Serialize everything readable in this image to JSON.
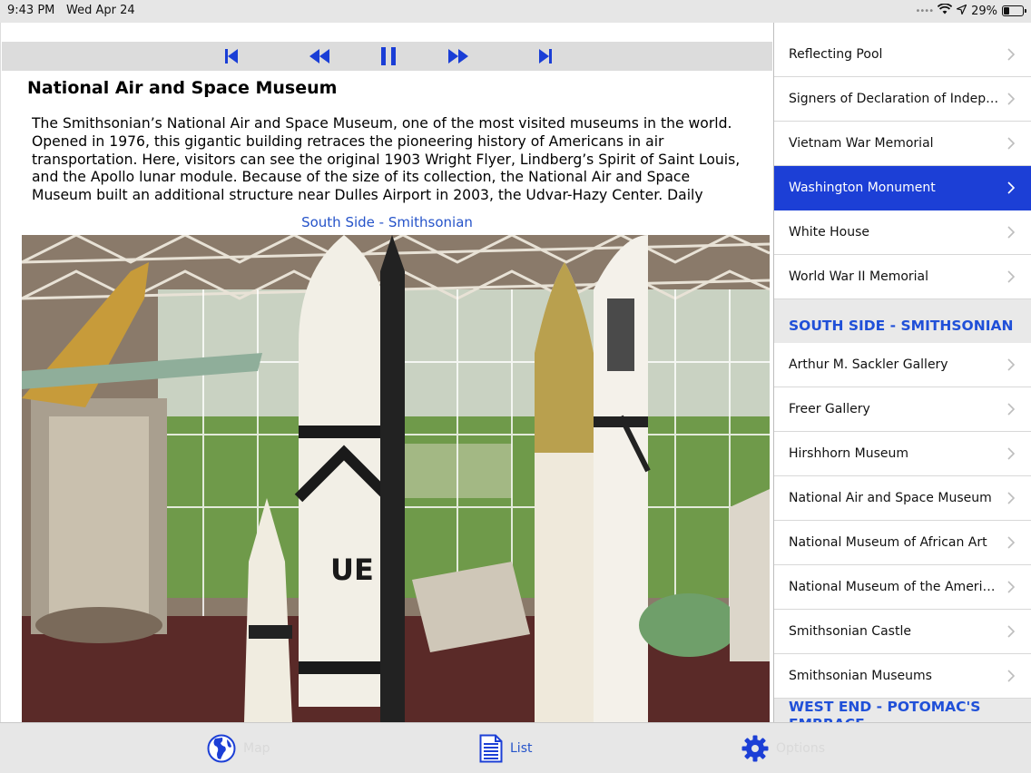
{
  "status_bar": {
    "time": "9:43 PM",
    "date": "Wed Apr 24",
    "battery": "29%",
    "battery_level": 0.29,
    "icons": [
      "wifi-icon",
      "location-icon",
      "battery-icon"
    ]
  },
  "player": {
    "controls": [
      "skip-to-start-icon",
      "rewind-icon",
      "pause-icon",
      "fast-forward-icon",
      "skip-to-end-icon"
    ]
  },
  "article": {
    "title": "National Air and Space Museum",
    "description": "The Smithsonian’s National Air and Space Museum, one of the most visited museums in the world. Opened in 1976, this gigantic building retraces the pioneering history of Americans in air transportation. Here, visitors can see the original 1903 Wright Flyer, Lindberg’s Spirit of Saint Louis, and the Apollo lunar module. Because of the size of its collection, the National Air and Space Museum built an additional structure near Dulles Airport in 2003, the Udvar-Hazy Center.  Daily shuttles from",
    "caption": "South Side - Smithsonian",
    "rocket_marking": "UE"
  },
  "list": {
    "rows_top": [
      {
        "label": "Reflecting Pool",
        "selected": false
      },
      {
        "label": "Signers of Declaration of Indepe...",
        "selected": false
      },
      {
        "label": "Vietnam War Memorial",
        "selected": false
      },
      {
        "label": "Washington Monument",
        "selected": true
      },
      {
        "label": "White House",
        "selected": false
      },
      {
        "label": "World War II Memorial",
        "selected": false
      }
    ],
    "section_south": "SOUTH SIDE - SMITHSONIAN",
    "rows_south": [
      {
        "label": "Arthur M. Sackler Gallery",
        "selected": false
      },
      {
        "label": "Freer Gallery",
        "selected": false
      },
      {
        "label": "Hirshhorn Museum",
        "selected": false
      },
      {
        "label": "National Air and Space Museum",
        "selected": false
      },
      {
        "label": "National Museum of African Art",
        "selected": false
      },
      {
        "label": "National Museum of the Americ...",
        "selected": false
      },
      {
        "label": "Smithsonian Castle",
        "selected": false
      },
      {
        "label": "Smithsonian Museums",
        "selected": false
      }
    ],
    "section_west": "WEST END - POTOMAC'S EMBRACE"
  },
  "tab_bar": {
    "map": {
      "label": "Map",
      "icon": "globe-icon"
    },
    "list": {
      "label": "List",
      "icon": "document-list-icon"
    },
    "options": {
      "label": "Options",
      "icon": "gear-icon"
    }
  },
  "colors": {
    "accent": "#1c3fd6",
    "caption": "#2553c9",
    "section_text": "#2050d8",
    "selected_row": "#1c3fd6"
  }
}
